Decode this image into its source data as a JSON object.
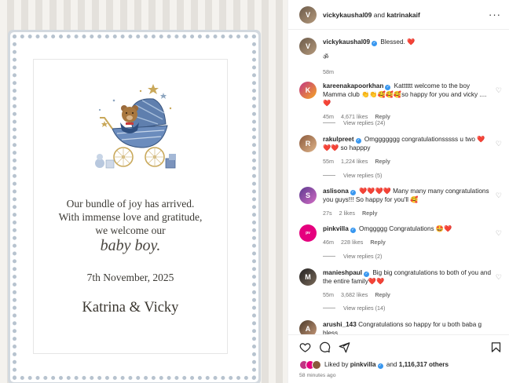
{
  "post": {
    "card": {
      "line1": "Our bundle of joy has arrived.",
      "line2": "With immense love and gratitude,",
      "line3": "we welcome our",
      "line4": "baby boy.",
      "date": "7th November, 2025",
      "names": "Katrina & Vicky"
    }
  },
  "header": {
    "user1": "vickykaushal09",
    "connector": "and",
    "user2": "katrinakaif",
    "more": "···"
  },
  "caption": {
    "user": "vickykaushal09",
    "text": "Blessed.",
    "heart": "❤️",
    "line2": "ॐ",
    "time": "58m"
  },
  "comments": [
    {
      "user": "kareenakapoorkhan",
      "text": "Katttttt welcome to the boy Mamma club 👏👏🥰🥰🥰so happy for you and vicky ....❤️",
      "time": "45m",
      "likes": "4,671 likes",
      "reply": "Reply",
      "view": "View replies (24)"
    },
    {
      "user": "rakulpreet",
      "text": "Omggggggg congratulationsssss u two ❤️❤️❤️ so happpy",
      "time": "55m",
      "likes": "1,224 likes",
      "reply": "Reply",
      "view": "View replies (5)"
    },
    {
      "user": "aslisona",
      "text": "❤️❤️❤️❤️ Many many many congratulations you guys!!! So happy for you'll 🥰",
      "time": "27s",
      "likes": "2 likes",
      "reply": "Reply",
      "view": ""
    },
    {
      "user": "pinkvilla",
      "text": "Omggggg Congratulations 🤩❤️",
      "time": "46m",
      "likes": "228 likes",
      "reply": "Reply",
      "view": "View replies (2)"
    },
    {
      "user": "manieshpaul",
      "text": "Big big congratulations to both of you and the entire family❤️❤️",
      "time": "55m",
      "likes": "3,682 likes",
      "reply": "Reply",
      "view": "View replies (14)"
    },
    {
      "user": "arushi_143",
      "text": "Congratulations so happy for u both baba g bless",
      "time": "",
      "likes": "",
      "reply": "",
      "view": ""
    }
  ],
  "likes": {
    "prefix": "Liked by",
    "user": "pinkvilla",
    "connector": "and",
    "others": "1,116,317 others",
    "time": "58 minutes ago"
  },
  "colors": {
    "verified": "#3897f0",
    "heart": "#ed4956",
    "muted": "#737373"
  }
}
